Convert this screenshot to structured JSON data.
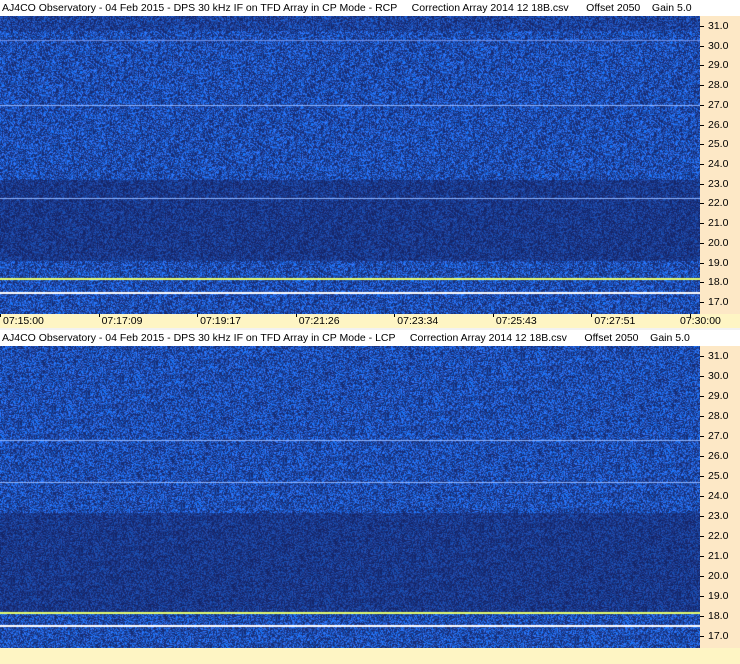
{
  "panels": [
    {
      "title": "AJ4CO Observatory - 04 Feb 2015 - DPS 30 kHz IF on TFD Array in CP Mode - RCP     Correction Array 2014 12 18B.csv      Offset 2050    Gain 5.0",
      "freq_ticks": [
        "31.0",
        "30.0",
        "29.0",
        "28.0",
        "27.0",
        "26.0",
        "25.0",
        "24.0",
        "23.0",
        "22.0",
        "21.0",
        "20.0",
        "19.0",
        "18.0",
        "17.0"
      ]
    },
    {
      "title": "AJ4CO Observatory - 04 Feb 2015 - DPS 30 kHz IF on TFD Array in CP Mode - LCP     Correction Array 2014 12 18B.csv      Offset 2050    Gain 5.0",
      "freq_ticks": [
        "31.0",
        "30.0",
        "29.0",
        "28.0",
        "27.0",
        "26.0",
        "25.0",
        "24.0",
        "23.0",
        "22.0",
        "21.0",
        "20.0",
        "19.0",
        "18.0",
        "17.0"
      ]
    }
  ],
  "time_axis": [
    "07:15:00",
    "07:17:09",
    "07:19:17",
    "07:21:26",
    "07:23:34",
    "07:25:43",
    "07:27:51",
    "07:30:00"
  ],
  "colors": {
    "spectrogram_base": "#1a3fa0",
    "axis_bg": "#fde8c6",
    "timebar_bg": "#fef5c4",
    "interference_line": "#e8ff70"
  }
}
